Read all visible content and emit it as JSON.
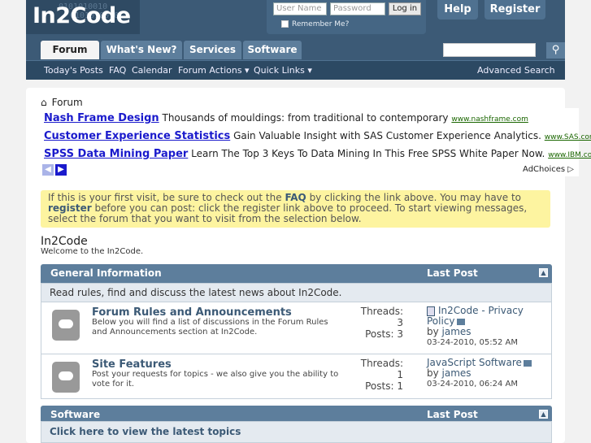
{
  "header": {
    "logo": "In2Code",
    "binary_line1": "0101010010",
    "binary_line2": "0101010010",
    "help_label": "Help",
    "register_label": "Register"
  },
  "login": {
    "username_placeholder": "User Name",
    "password_placeholder": "Password",
    "button_label": "Log in",
    "remember_label": "Remember Me?"
  },
  "nav": {
    "tabs": [
      "Forum",
      "What's New?",
      "Services",
      "Software"
    ],
    "sub_items": [
      "Today's Posts",
      "FAQ",
      "Calendar",
      "Forum Actions ▾",
      "Quick Links ▾"
    ],
    "advanced_search": "Advanced Search"
  },
  "breadcrumb": {
    "label": "Forum"
  },
  "ads": [
    {
      "title": "Nash Frame Design",
      "text": "Thousands of mouldings: from traditional to contemporary",
      "url": "www.nashframe.com"
    },
    {
      "title": "Customer Experience Statistics",
      "text": "Gain Valuable Insight with SAS Customer Experience Analytics.",
      "url": "www.SAS.com"
    },
    {
      "title": "SPSS Data Mining Paper",
      "text": "Learn The Top 3 Keys To Data Mining In This Free SPSS White Paper Now.",
      "url": "www.IBM.com/"
    }
  ],
  "adchoices": "AdChoices ▷",
  "notice": {
    "part1": "If this is your first visit, be sure to check out the ",
    "faq": "FAQ",
    "part2": " by clicking the link above. You may have to ",
    "register": "register",
    "part3": " before you can post: click the register link above to proceed. To start viewing messages, select the forum that you want to visit from the selection below."
  },
  "site": {
    "title": "In2Code",
    "description": "Welcome to the In2Code."
  },
  "categories": [
    {
      "title": "General Information",
      "last_post_header": "Last Post",
      "description": "Read rules, find and discuss the latest news about In2Code.",
      "forums": [
        {
          "title": "Forum Rules and Announcements",
          "description": "Below you will find a list of discussions in the Forum Rules and Announcements section at In2Code.",
          "threads_label": "Threads:",
          "threads": "3",
          "posts_label": "Posts:",
          "posts": "3",
          "last_post_title": "In2Code - Privacy Policy",
          "last_post_by": "by",
          "last_post_user": "james",
          "last_post_date": "03-24-2010,",
          "last_post_time": "05:52 AM"
        },
        {
          "title": "Site Features",
          "description": "Post your requests for topics - we also give you the ability to vote for it.",
          "threads_label": "Threads:",
          "threads": "1",
          "posts_label": "Posts:",
          "posts": "1",
          "last_post_title": "JavaScript Software",
          "last_post_by": "by",
          "last_post_user": "james",
          "last_post_date": "03-24-2010,",
          "last_post_time": "06:24 AM"
        }
      ]
    },
    {
      "title": "Software",
      "last_post_header": "Last Post",
      "latest_link": "Click here to view the latest topics"
    }
  ]
}
